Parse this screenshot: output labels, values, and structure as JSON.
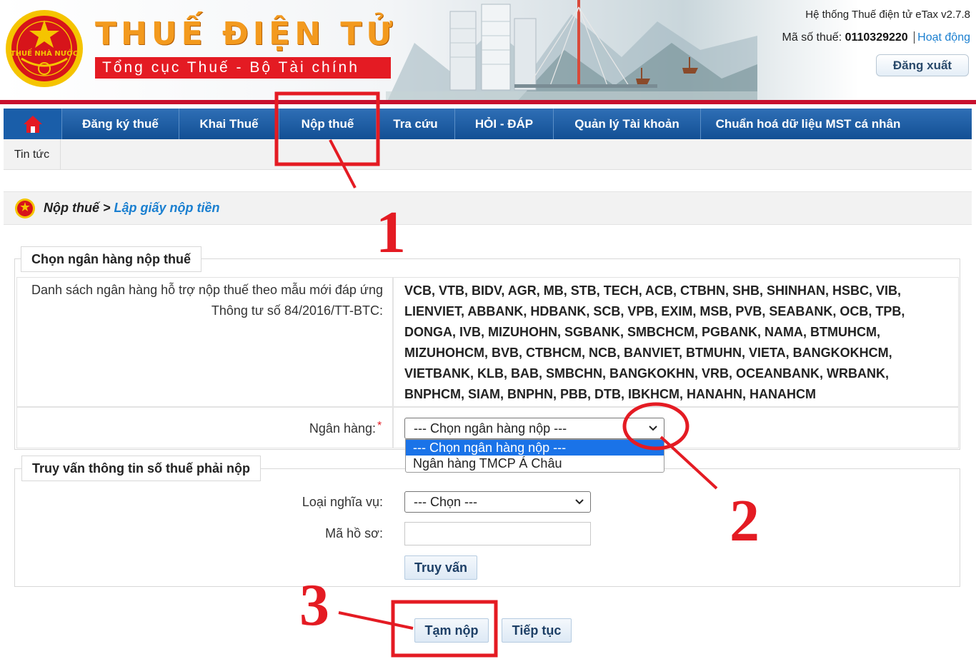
{
  "header": {
    "brand_title": "THUẾ ĐIỆN TỬ",
    "brand_subtitle": "Tổng cục Thuế - Bộ Tài chính",
    "emblem_text": "THUẾ NHÀ NƯỚC",
    "system_name": "Hệ thống Thuế điện tử eTax v2.7.8",
    "tax_code_label": "Mã số thuế:",
    "tax_code_value": "0110329220",
    "status": "Hoạt động",
    "logout_label": "Đăng xuất"
  },
  "nav": {
    "items": [
      {
        "label": "Đăng ký thuế"
      },
      {
        "label": "Khai Thuế"
      },
      {
        "label": "Nộp thuế"
      },
      {
        "label": "Tra cứu"
      },
      {
        "label": "HỎI - ĐÁP"
      },
      {
        "label": "Quản lý Tài khoản"
      },
      {
        "label": "Chuẩn hoá dữ liệu MST cá nhân"
      }
    ],
    "sub_items": [
      {
        "label": "Tin tức"
      }
    ]
  },
  "breadcrumb": {
    "root": "Nộp thuế",
    "separator": " > ",
    "current": "Lập giấy nộp tiền"
  },
  "bank_section": {
    "legend": "Chọn ngân hàng nộp thuế",
    "list_label": "Danh sách ngân hàng hỗ trợ nộp thuế theo mẫu mới đáp ứng Thông tư số 84/2016/TT-BTC:",
    "bank_list": "VCB, VTB, BIDV, AGR, MB, STB, TECH, ACB, CTBHN, SHB, SHINHAN, HSBC, VIB, LIENVIET, ABBANK, HDBANK, SCB, VPB, EXIM, MSB, PVB, SEABANK, OCB, TPB, DONGA, IVB, MIZUHOHN, SGBANK, SMBCHCM, PGBANK, NAMA, BTMUHCM, MIZUHOHCM, BVB, CTBHCM, NCB, BANVIET, BTMUHN, VIETA, BANGKOKHCM, VIETBANK, KLB, BAB, SMBCHN, BANGKOKHN, VRB, OCEANBANK, WRBANK, BNPHCM, SIAM, BNPHN, PBB, DTB, IBKHCM, HANAHN, HANAHCM",
    "bank_label": "Ngân hàng:",
    "required_mark": "*",
    "bank_select_value": "--- Chọn ngân hàng nộp ---",
    "bank_options": [
      "--- Chọn ngân hàng nộp ---",
      "Ngân hàng TMCP Á Châu"
    ]
  },
  "query_section": {
    "legend": "Truy vấn thông tin số thuế phải nộp",
    "obligation_label": "Loại nghĩa vụ:",
    "obligation_value": "--- Chọn ---",
    "record_label": "Mã hồ sơ:",
    "record_value": "",
    "query_button": "Truy vấn"
  },
  "actions": {
    "temp_pay": "Tạm nộp",
    "continue": "Tiếp tục"
  },
  "annotations": {
    "step1": "1",
    "step2": "2",
    "step3": "3",
    "color": "#e41b23"
  }
}
